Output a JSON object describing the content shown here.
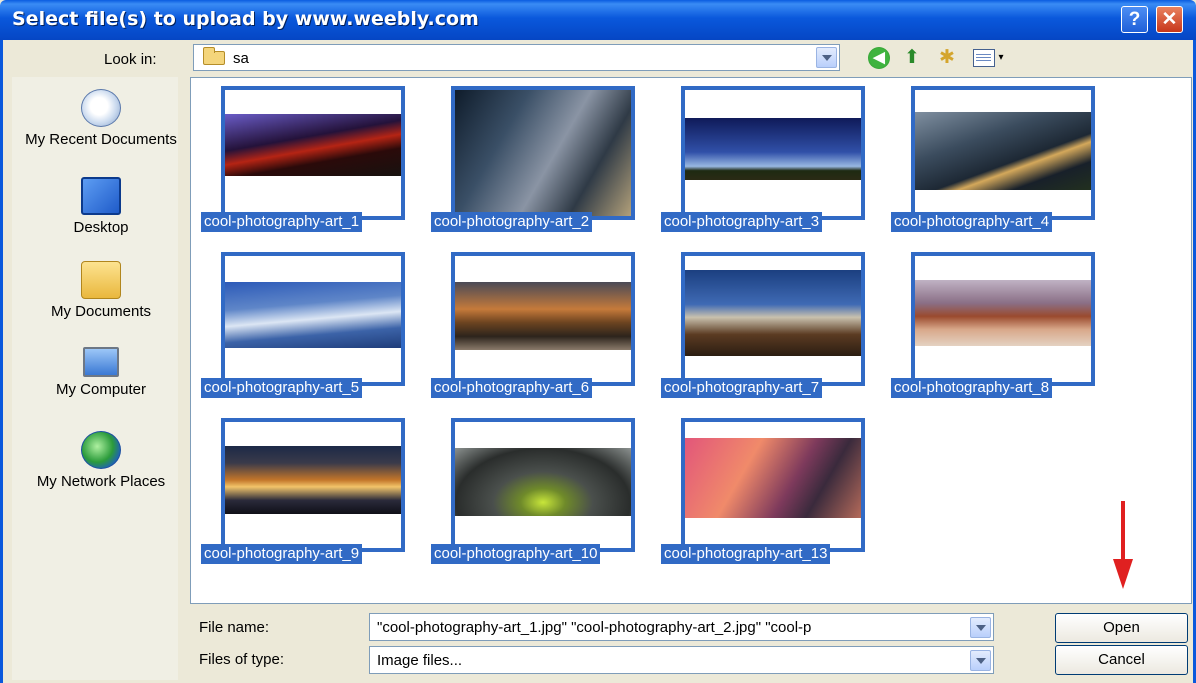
{
  "window": {
    "title": "Select file(s) to upload by www.weebly.com",
    "help_glyph": "?",
    "close_glyph": "✕"
  },
  "toolbar": {
    "lookin_label": "Look in:",
    "lookin_value": "sa",
    "back_icon": "back-arrow-icon",
    "up_icon": "up-folder-icon",
    "new_folder_icon": "new-folder-icon",
    "views_icon": "views-menu-icon"
  },
  "places": [
    {
      "label": "My Recent Documents",
      "icon": "recent-documents-icon"
    },
    {
      "label": "Desktop",
      "icon": "desktop-icon"
    },
    {
      "label": "My Documents",
      "icon": "my-documents-icon"
    },
    {
      "label": "My Computer",
      "icon": "my-computer-icon"
    },
    {
      "label": "My Network Places",
      "icon": "network-places-icon"
    }
  ],
  "files": [
    {
      "name": "cool-photography-art_1",
      "selected": true
    },
    {
      "name": "cool-photography-art_2",
      "selected": true
    },
    {
      "name": "cool-photography-art_3",
      "selected": true
    },
    {
      "name": "cool-photography-art_4",
      "selected": true
    },
    {
      "name": "cool-photography-art_5",
      "selected": true
    },
    {
      "name": "cool-photography-art_6",
      "selected": true
    },
    {
      "name": "cool-photography-art_7",
      "selected": true
    },
    {
      "name": "cool-photography-art_8",
      "selected": true
    },
    {
      "name": "cool-photography-art_9",
      "selected": true
    },
    {
      "name": "cool-photography-art_10",
      "selected": true
    },
    {
      "name": "cool-photography-art_13",
      "selected": true
    }
  ],
  "bottom": {
    "filename_label": "File name:",
    "filename_value": "\"cool-photography-art_1.jpg\" \"cool-photography-art_2.jpg\" \"cool-p",
    "filetype_label": "Files of type:",
    "filetype_value": "Image files...",
    "open_label": "Open",
    "cancel_label": "Cancel"
  },
  "colors": {
    "title_bar": "#0a58dc",
    "selection": "#316ac5",
    "annotation_arrow": "#e02020"
  }
}
